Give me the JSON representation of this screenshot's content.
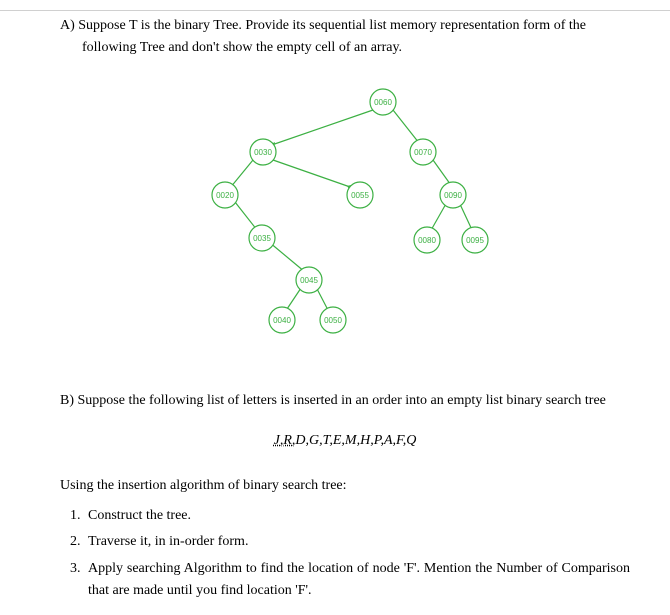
{
  "partA": {
    "line1": "A) Suppose T is the binary Tree. Provide its sequential list memory representation form of the",
    "line2": "following Tree and don't show the empty cell of an array."
  },
  "tree": {
    "nodes": {
      "root": "0060",
      "n30": "0030",
      "n70": "0070",
      "n20": "0020",
      "n55": "0055",
      "n90": "0090",
      "n35": "0035",
      "n80": "0080",
      "n95": "0095",
      "n45": "0045",
      "n40": "0040",
      "n50": "0050"
    },
    "strokeColor": "#3cb043",
    "textColor": "#3cb043"
  },
  "partB": {
    "intro": "B) Suppose the following list of letters is inserted in an order into an empty list binary search tree",
    "letters_first": "J,R,",
    "letters_rest": "D,G,T,E,M,H,P,A,F,Q",
    "using": "Using the insertion algorithm of binary search tree:",
    "tasks": {
      "t1": "Construct the tree.",
      "t2": "Traverse it, in in-order form.",
      "t3": "Apply searching Algorithm to find the location of node 'F'. Mention the Number of Comparison that are made until you find location 'F'."
    }
  }
}
